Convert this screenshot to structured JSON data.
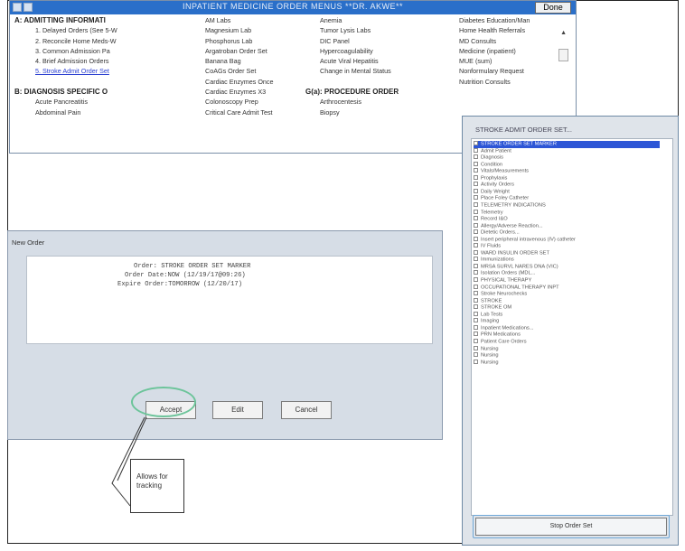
{
  "menu": {
    "title": "INPATIENT MEDICINE ORDER MENUS **DR. AKWE**",
    "done_label": "Done",
    "col1": [
      {
        "text": "A: ADMITTING INFORMATI",
        "style": "head"
      },
      {
        "text": "1. Delayed Orders (See 5-W",
        "style": "indent"
      },
      {
        "text": "2. Reconcile Home Meds-W",
        "style": "indent"
      },
      {
        "text": "3. Common Admission Pa",
        "style": "indent"
      },
      {
        "text": "4. Brief Admission Orders",
        "style": "indent"
      },
      {
        "text": "5. Stroke Admit Order Set",
        "style": "link"
      },
      {
        "text": "",
        "style": ""
      },
      {
        "text": "B: DIAGNOSIS SPECIFIC O",
        "style": "head"
      },
      {
        "text": "Acute Pancreatitis",
        "style": "indent"
      },
      {
        "text": "Abdominal Pain",
        "style": "indent"
      }
    ],
    "col2": [
      "AM Labs",
      "Magnesium Lab",
      "Phosphorus Lab",
      "Argatroban Order Set",
      "Banana Bag",
      "CoAGs Order Set",
      "Cardiac Enzymes Once",
      "Cardiac Enzymes X3",
      "Colonoscopy Prep",
      "Critical Care Admit Test"
    ],
    "col3": [
      {
        "text": "Anemia",
        "style": ""
      },
      {
        "text": "Tumor Lysis Labs",
        "style": ""
      },
      {
        "text": "DIC Panel",
        "style": ""
      },
      {
        "text": "Hypercoagulability",
        "style": ""
      },
      {
        "text": "Acute Viral Hepatitis",
        "style": ""
      },
      {
        "text": "Change in Mental Status",
        "style": ""
      },
      {
        "text": "",
        "style": ""
      },
      {
        "text": "G(a): PROCEDURE ORDER",
        "style": "head"
      },
      {
        "text": "Arthrocentesis",
        "style": ""
      },
      {
        "text": "Biopsy",
        "style": ""
      }
    ],
    "col4": [
      "Diabetes Education/Man",
      "Home Health Referrals",
      "MD Consults",
      "Medicine (inpatient)",
      "MUE (sum)",
      "Nonformulary Request",
      "Nutrition Consults"
    ]
  },
  "new_order": {
    "title": "New Order",
    "lines": [
      "Order: STROKE ORDER SET MARKER",
      "Order Date:NOW (12/19/17@09:26)",
      "Expire Order:TOMORROW (12/20/17)"
    ],
    "accept": "Accept",
    "edit": "Edit",
    "cancel": "Cancel"
  },
  "callout": {
    "line1": "Allows for",
    "line2": "tracking"
  },
  "order_set": {
    "title": "STROKE ADMIT ORDER SET...",
    "selected_index": 0,
    "items": [
      "STROKE ORDER SET MARKER",
      "Admit Patient",
      "Diagnosis",
      "Condition",
      "Vitals/Measurements",
      "Prophylaxis",
      "Activity Orders",
      "Daily Weight",
      "Place Foley Catheter",
      "TELEMETRY INDICATIONS",
      "Telemetry",
      "Record I&O",
      "Allergy/Adverse Reaction...",
      "Dietetic Orders...",
      "Insert peripheral intravenous (IV) catheter",
      "IV Fluids",
      "WARD INSULIN ORDER SET",
      "Immunizations",
      "MRSA SURVL NARES DNA (VIC)",
      "Isolation Orders (MDL...",
      "PHYSICAL THERAPY",
      "OCCUPATIONAL THERAPY INPT",
      "Stroke Neurochecks",
      "STROKE",
      "STROKE OM",
      "Lab Tests",
      "Imaging",
      "Inpatient Medications...",
      "PRN Medications",
      "Patient Care Orders",
      "Nursing",
      "Nursing",
      "Nursing"
    ],
    "stop_label": "Stop Order Set"
  }
}
